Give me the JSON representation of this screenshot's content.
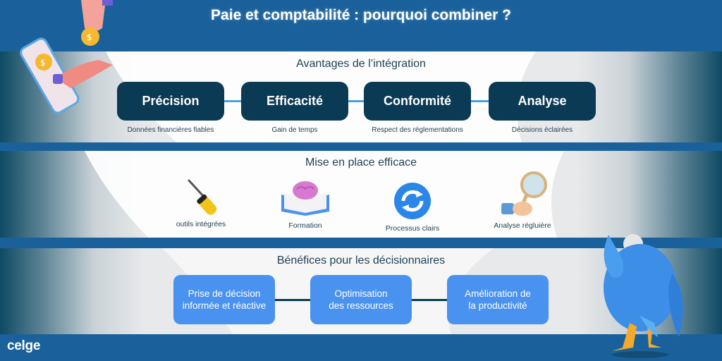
{
  "header": {
    "title": "Paie et comptabilité : pourquoi combiner ?"
  },
  "colors": {
    "brand_blue": "#1a619b",
    "dark_navy": "#0b3b54",
    "light_blue": "#4a92f0",
    "connector_light": "#4a9fe8",
    "text": "#1d3f52"
  },
  "advantages": {
    "title": "Avantages de l’intégration",
    "items": [
      {
        "label": "Précision",
        "caption": "Données financières fiables"
      },
      {
        "label": "Efficacité",
        "caption": "Gain de temps"
      },
      {
        "label": "Conformité",
        "caption": "Respect des réglementations"
      },
      {
        "label": "Analyse",
        "caption": "Décisions éclairées"
      }
    ]
  },
  "setup": {
    "title": "Mise en place efficace",
    "items": [
      {
        "icon": "screwdriver-icon",
        "label": "outils intégrées"
      },
      {
        "icon": "brain-book-icon",
        "label": "Formation"
      },
      {
        "icon": "refresh-cycle-icon",
        "label": "Processus clairs"
      },
      {
        "icon": "magnifier-hand-icon",
        "label": "Analyse régluière"
      }
    ]
  },
  "benefits": {
    "title": "Bénéfices pour les décisionnaires",
    "items": [
      {
        "line1": "Prise de décision",
        "line2": "informée et réactive"
      },
      {
        "line1": "Optimisation",
        "line2": "des ressources"
      },
      {
        "line1": "Amélioration de",
        "line2": "la productivité"
      }
    ]
  },
  "footer": {
    "logo": "celge"
  }
}
